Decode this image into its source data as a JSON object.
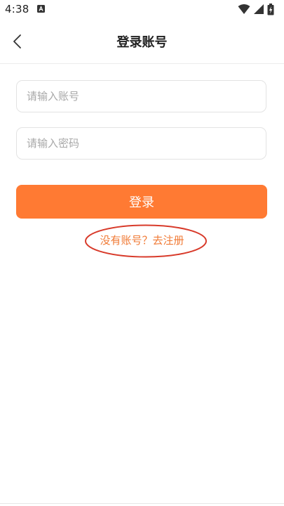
{
  "status": {
    "time": "4:38",
    "icons": [
      "a-notification-icon",
      "wifi-icon",
      "signal-icon",
      "battery-icon"
    ]
  },
  "nav": {
    "title": "登录账号",
    "back_icon": "chevron-left-icon"
  },
  "form": {
    "account_placeholder": "请输入账号",
    "password_placeholder": "请输入密码",
    "login_label": "登录",
    "register_link": "没有账号？去注册"
  },
  "colors": {
    "accent": "#ff7a33",
    "link": "#f07a35",
    "annotation": "#d83a2a"
  }
}
